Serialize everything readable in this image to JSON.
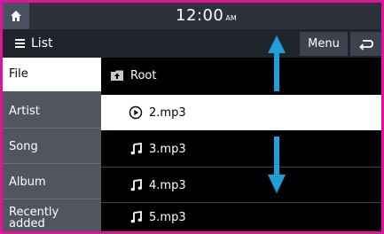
{
  "status_bar": {
    "time": "12:00",
    "ampm": "AM",
    "home_icon": "home-icon"
  },
  "title_bar": {
    "title": "List",
    "title_icon": "list-icon",
    "menu_label": "Menu",
    "back_icon": "back-arrow-icon"
  },
  "categories": [
    {
      "label": "File",
      "active": true
    },
    {
      "label": "Artist",
      "active": false
    },
    {
      "label": "Song",
      "active": false
    },
    {
      "label": "Album",
      "active": false
    },
    {
      "label": "Recently added",
      "active": false
    }
  ],
  "files": [
    {
      "name": "Root",
      "icon": "folder-up-icon",
      "state": "folder"
    },
    {
      "name": "2.mp3",
      "icon": "play-circle-icon",
      "state": "playing"
    },
    {
      "name": "3.mp3",
      "icon": "music-note-icon",
      "state": "normal"
    },
    {
      "name": "4.mp3",
      "icon": "music-note-icon",
      "state": "normal"
    },
    {
      "name": "5.mp3",
      "icon": "music-note-icon",
      "state": "normal"
    }
  ],
  "annotations": {
    "scroll_up_arrow": "scroll-up-arrow",
    "scroll_down_arrow": "scroll-down-arrow"
  },
  "colors": {
    "border": "#e0149a",
    "status_bar": "#2c313c",
    "title_bar": "#1f232c",
    "category_panel": "#505560",
    "list_background": "#000000",
    "selected_row": "#ffffff",
    "annotation_arrow": "#1e9fd8"
  }
}
